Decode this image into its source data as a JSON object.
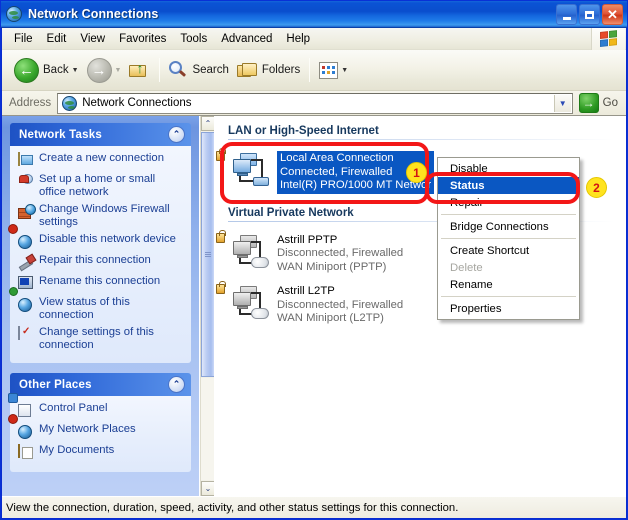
{
  "window": {
    "title": "Network Connections",
    "title_icon": "network-globe-icon",
    "buttons": {
      "minimize": "Minimize",
      "maximize": "Maximize",
      "close": "Close"
    }
  },
  "menubar": {
    "items": [
      {
        "label": "File"
      },
      {
        "label": "Edit"
      },
      {
        "label": "View"
      },
      {
        "label": "Favorites"
      },
      {
        "label": "Tools"
      },
      {
        "label": "Advanced"
      },
      {
        "label": "Help"
      }
    ],
    "flag_icon": "windows-flag-icon"
  },
  "toolbar": {
    "back_label": "Back",
    "back_icon": "back-arrow-icon",
    "forward_icon": "forward-arrow-icon",
    "up_icon": "up-folder-icon",
    "search_label": "Search",
    "search_icon": "search-magnifier-icon",
    "folders_label": "Folders",
    "folders_icon": "folders-icon",
    "views_icon": "views-icon"
  },
  "address": {
    "label": "Address",
    "value": "Network Connections",
    "placeholder": "Network Connections",
    "icon": "network-globe-icon",
    "dropdown_icon": "chevron-down-icon",
    "go_label": "Go",
    "go_icon": "go-arrow-icon"
  },
  "sidebar": {
    "panels": [
      {
        "title": "Network Tasks",
        "collapse_icon": "chevron-up-icon",
        "items": [
          {
            "label": "Create a new connection",
            "icon": "new-connection-icon"
          },
          {
            "label": "Set up a home or small office network",
            "icon": "home-network-icon"
          },
          {
            "label": "Change Windows Firewall settings",
            "icon": "firewall-icon"
          },
          {
            "label": "Disable this network device",
            "icon": "disable-device-icon"
          },
          {
            "label": "Repair this connection",
            "icon": "wrench-icon"
          },
          {
            "label": "Rename this connection",
            "icon": "rename-icon"
          },
          {
            "label": "View status of this connection",
            "icon": "view-status-icon"
          },
          {
            "label": "Change settings of this connection",
            "icon": "properties-icon"
          }
        ]
      },
      {
        "title": "Other Places",
        "collapse_icon": "chevron-up-icon",
        "items": [
          {
            "label": "Control Panel",
            "icon": "control-panel-icon"
          },
          {
            "label": "My Network Places",
            "icon": "network-places-icon"
          },
          {
            "label": "My Documents",
            "icon": "my-documents-icon"
          }
        ]
      }
    ]
  },
  "content": {
    "groups": [
      {
        "title": "LAN or High-Speed Internet",
        "connections": [
          {
            "name": "Local Area Connection",
            "status": "Connected, Firewalled",
            "device": "Intel(R) PRO/1000 MT Networ",
            "selected": true,
            "icon": "lan-connection-icon"
          }
        ]
      },
      {
        "title": "Virtual Private Network",
        "connections": [
          {
            "name": "Astrill PPTP",
            "status": "Disconnected, Firewalled",
            "device": "WAN Miniport (PPTP)",
            "selected": false,
            "icon": "vpn-connection-icon"
          },
          {
            "name": "Astrill L2TP",
            "status": "Disconnected, Firewalled",
            "device": "WAN Miniport (L2TP)",
            "selected": false,
            "icon": "vpn-connection-icon"
          }
        ]
      }
    ]
  },
  "context_menu": {
    "items": [
      {
        "label": "Disable",
        "state": "normal"
      },
      {
        "label": "Status",
        "state": "selected"
      },
      {
        "label": "Repair",
        "state": "normal"
      },
      {
        "separator": true
      },
      {
        "label": "Bridge Connections",
        "state": "normal"
      },
      {
        "separator": true
      },
      {
        "label": "Create Shortcut",
        "state": "normal"
      },
      {
        "label": "Delete",
        "state": "disabled"
      },
      {
        "label": "Rename",
        "state": "normal"
      },
      {
        "separator": true
      },
      {
        "label": "Properties",
        "state": "normal"
      }
    ]
  },
  "statusbar": {
    "text": "View the connection, duration, speed, activity, and other status settings for this connection."
  },
  "annotations": {
    "badges": [
      {
        "number": "1"
      },
      {
        "number": "2"
      }
    ],
    "highlight_color": "#f31717",
    "badge_fill": "#ffe31f",
    "badge_text_color": "#d21313"
  },
  "scrollbar": {
    "up_icon": "chevron-up-icon",
    "down_icon": "chevron-down-icon"
  },
  "colors": {
    "title_blue": "#0a53d4",
    "selection_blue": "#0a57c2",
    "sidebar_blue": "#8fb0ec",
    "task_link": "#1b3f94"
  }
}
